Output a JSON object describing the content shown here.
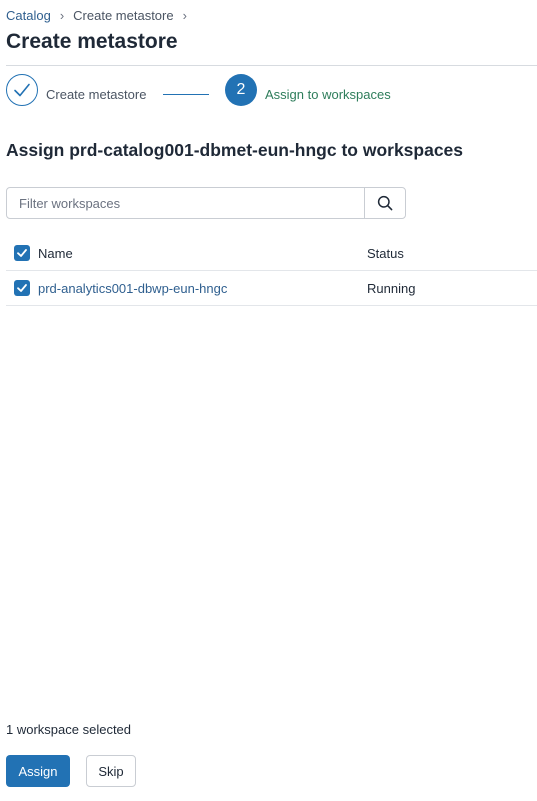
{
  "breadcrumb": {
    "items": [
      {
        "label": "Catalog"
      },
      {
        "label": "Create metastore"
      }
    ],
    "separator": "›"
  },
  "page": {
    "title": "Create metastore"
  },
  "stepper": {
    "steps": [
      {
        "label": "Create metastore",
        "state": "complete",
        "icon": "check-icon"
      },
      {
        "label": "Assign to workspaces",
        "state": "active",
        "number": "2"
      }
    ],
    "colors": {
      "accent": "#2272b4",
      "active_label": "#2e7d5b"
    }
  },
  "assign": {
    "title": "Assign prd-catalog001-dbmet-eun-hngc to workspaces"
  },
  "filter": {
    "placeholder": "Filter workspaces",
    "value": "",
    "icon": "search-icon"
  },
  "table": {
    "columns": {
      "name": "Name",
      "status": "Status"
    },
    "select_all_checked": true,
    "rows": [
      {
        "name": "prd-analytics001-dbwp-eun-hngc",
        "status": "Running",
        "checked": true
      }
    ]
  },
  "footer": {
    "selected_text": "1 workspace selected",
    "assign_label": "Assign",
    "skip_label": "Skip"
  }
}
